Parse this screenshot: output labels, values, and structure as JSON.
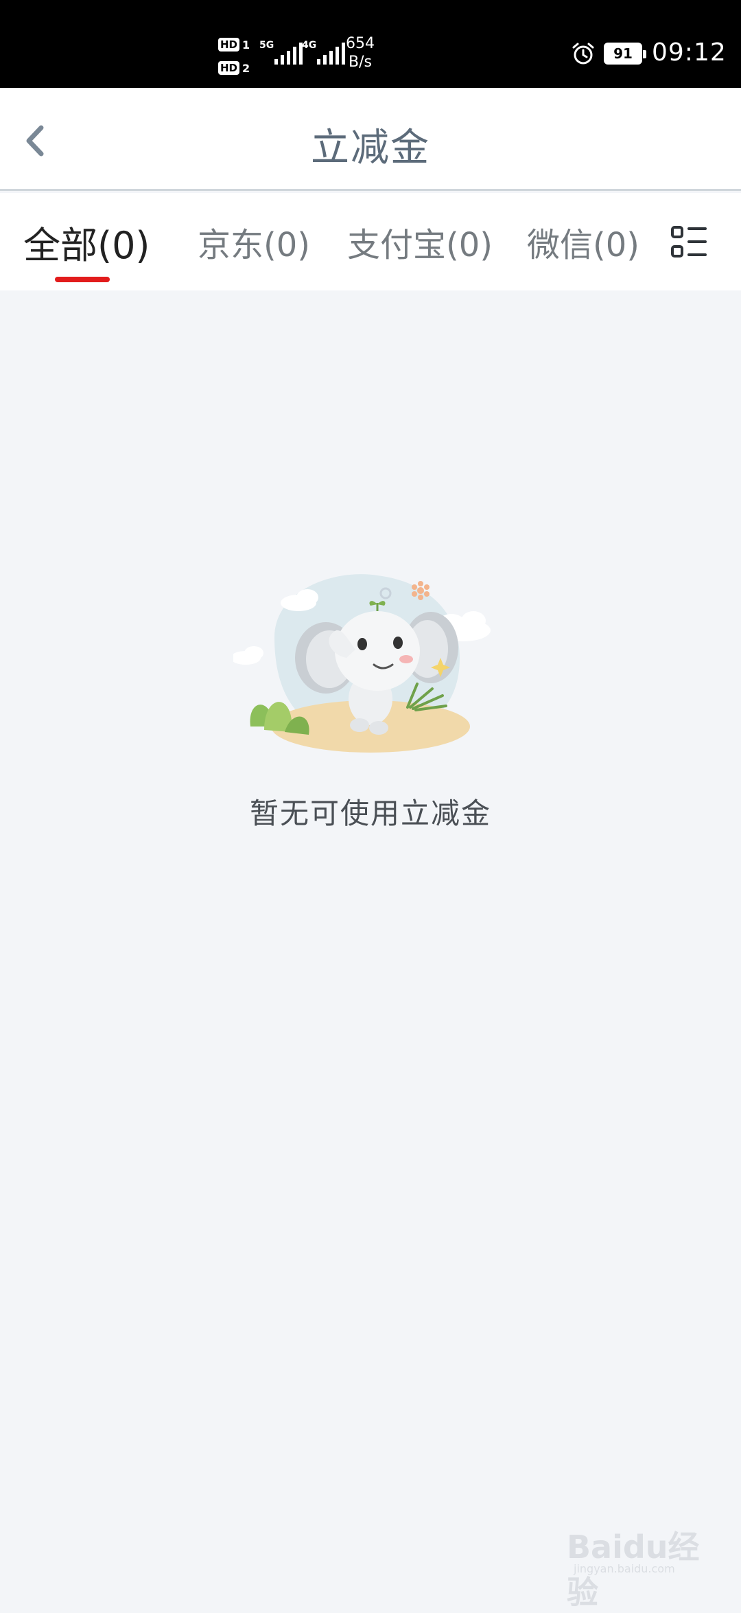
{
  "status_bar": {
    "hd1": "HD",
    "hd1_num": "1",
    "hd2": "HD",
    "hd2_num": "2",
    "net1": "5G",
    "net2": "4G",
    "speed_value": "654",
    "speed_unit": "B/s",
    "battery": "91",
    "time": "09:12"
  },
  "nav": {
    "title": "立减金",
    "back_icon": "chevron-left-icon"
  },
  "tabs": [
    {
      "label": "全部(0)",
      "active": true
    },
    {
      "label": "京东(0)",
      "active": false
    },
    {
      "label": "支付宝(0)",
      "active": false
    },
    {
      "label": "微信(0)",
      "active": false
    }
  ],
  "menu_icon": "list-menu-icon",
  "empty_state": {
    "text": "暂无可使用立减金",
    "illustration": "elephant-mascot"
  },
  "watermark": {
    "logo": "Baidu经验",
    "url": "jingyan.baidu.com"
  },
  "colors": {
    "accent": "#e21c1c",
    "title": "#5c6b7a",
    "background": "#f3f5f8"
  }
}
